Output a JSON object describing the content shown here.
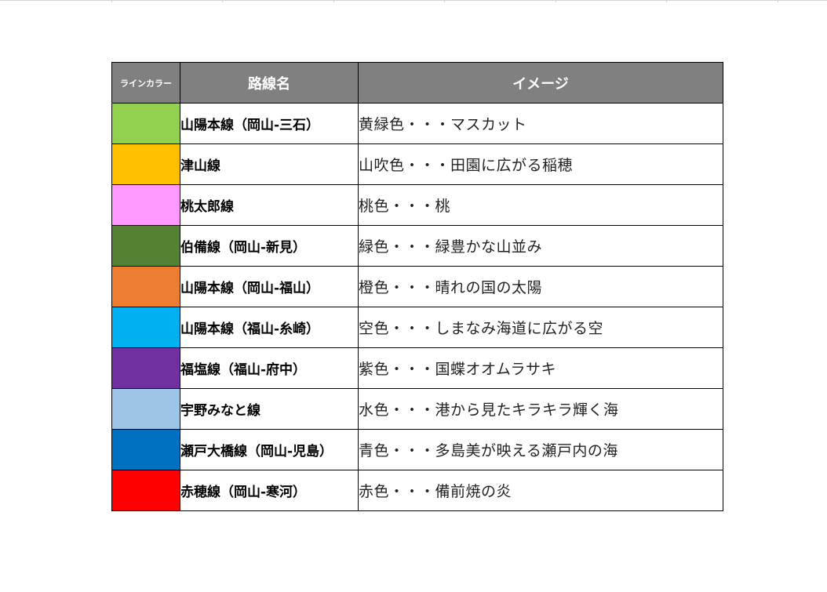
{
  "table": {
    "headers": {
      "color": "ラインカラー",
      "name": "路線名",
      "image": "イメージ"
    },
    "rows": [
      {
        "color": "#92d050",
        "name": "山陽本線（岡山-三石）",
        "image": "黄緑色・・・マスカット"
      },
      {
        "color": "#ffc000",
        "name": "津山線",
        "image": "山吹色・・・田園に広がる稲穂"
      },
      {
        "color": "#ff99ff",
        "name": "桃太郎線",
        "image": "桃色・・・桃"
      },
      {
        "color": "#548235",
        "name": "伯備線（岡山-新見）",
        "image": "緑色・・・緑豊かな山並み"
      },
      {
        "color": "#ed7d31",
        "name": "山陽本線（岡山-福山）",
        "image": "橙色・・・晴れの国の太陽"
      },
      {
        "color": "#00b0f0",
        "name": "山陽本線（福山-糸崎）",
        "image": "空色・・・しまなみ海道に広がる空"
      },
      {
        "color": "#7030a0",
        "name": "福塩線（福山-府中）",
        "image": "紫色・・・国蝶オオムラサキ"
      },
      {
        "color": "#9dc3e6",
        "name": "宇野みなと線",
        "image": "水色・・・港から見たキラキラ輝く海"
      },
      {
        "color": "#0070c0",
        "name": "瀬戸大橋線（岡山-児島）",
        "image": "青色・・・多島美が映える瀬戸内の海"
      },
      {
        "color": "#ff0000",
        "name": "赤穂線（岡山-寒河）",
        "image": "赤色・・・備前焼の炎"
      }
    ]
  }
}
